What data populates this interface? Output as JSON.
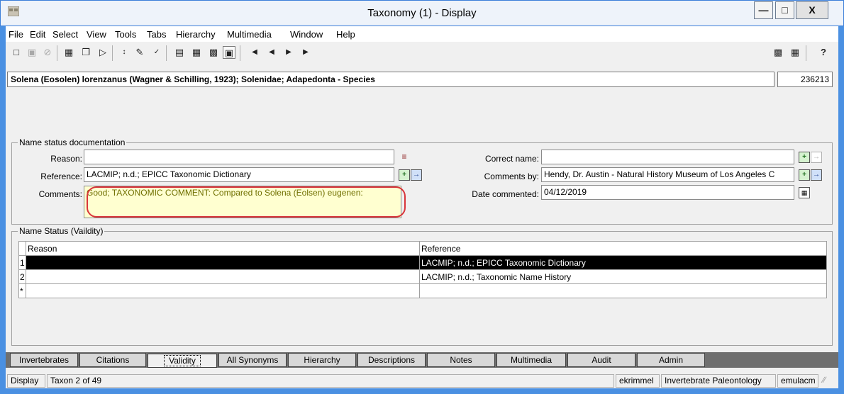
{
  "window": {
    "title": "Taxonomy (1) - Display",
    "buttons": {
      "minimize": "―",
      "maximize": "□",
      "close": "X"
    }
  },
  "menu": [
    "File",
    "Edit",
    "Select",
    "View",
    "Tools",
    "Tabs",
    "Hierarchy",
    "Multimedia",
    "Window",
    "Help"
  ],
  "toolbar": {
    "icons": [
      "new-icon",
      "save-icon",
      "cancel-icon",
      "new-record-icon",
      "copy-record-icon",
      "delete-record-icon",
      "sort-icon",
      "edit-icon",
      "spellcheck-icon",
      "page-view-icon",
      "list-view-icon",
      "details-view-icon",
      "form-view-icon",
      "first-record-icon",
      "previous-record-icon",
      "next-record-icon",
      "last-record-icon",
      "attach-icon",
      "report-icon",
      "help-icon"
    ]
  },
  "record": {
    "title": "Solena (Eosolen) lorenzanus (Wagner & Schilling, 1923); Solenidae; Adapedonta - Species",
    "id": "236213"
  },
  "name_status_doc": {
    "legend": "Name status documentation",
    "reason_label": "Reason:",
    "reason_value": "",
    "reference_label": "Reference:",
    "reference_value": "LACMIP; n.d.; EPICC Taxonomic Dictionary",
    "comments_label": "Comments:",
    "comments_value": "Good; TAXONOMIC COMMENT: Compared to Solena (Eolsen) eugenen:",
    "correct_name_label": "Correct name:",
    "correct_name_value": "",
    "comments_by_label": "Comments by:",
    "comments_by_value": "Hendy, Dr. Austin - Natural History Museum of Los Angeles C",
    "date_commented_label": "Date commented:",
    "date_commented_value": "04/12/2019"
  },
  "name_status_grid": {
    "legend": "Name Status (Vaildity)",
    "columns": [
      "Reason",
      "Reference"
    ],
    "rows": [
      {
        "num": "1",
        "reason": "",
        "reference": "LACMIP; n.d.; EPICC Taxonomic Dictionary"
      },
      {
        "num": "2",
        "reason": "",
        "reference": "LACMIP; n.d.; Taxonomic Name History"
      },
      {
        "num": "*",
        "reason": "",
        "reference": ""
      }
    ]
  },
  "tabs": [
    "Invertebrates",
    "Citations",
    "Validity",
    "All Synonyms",
    "Hierarchy",
    "Descriptions",
    "Notes",
    "Multimedia",
    "Audit",
    "Admin"
  ],
  "status": {
    "mode": "Display",
    "position": "Taxon 2 of 49",
    "user": "ekrimmel",
    "department": "Invertebrate Paleontology",
    "host": "emulacm"
  }
}
